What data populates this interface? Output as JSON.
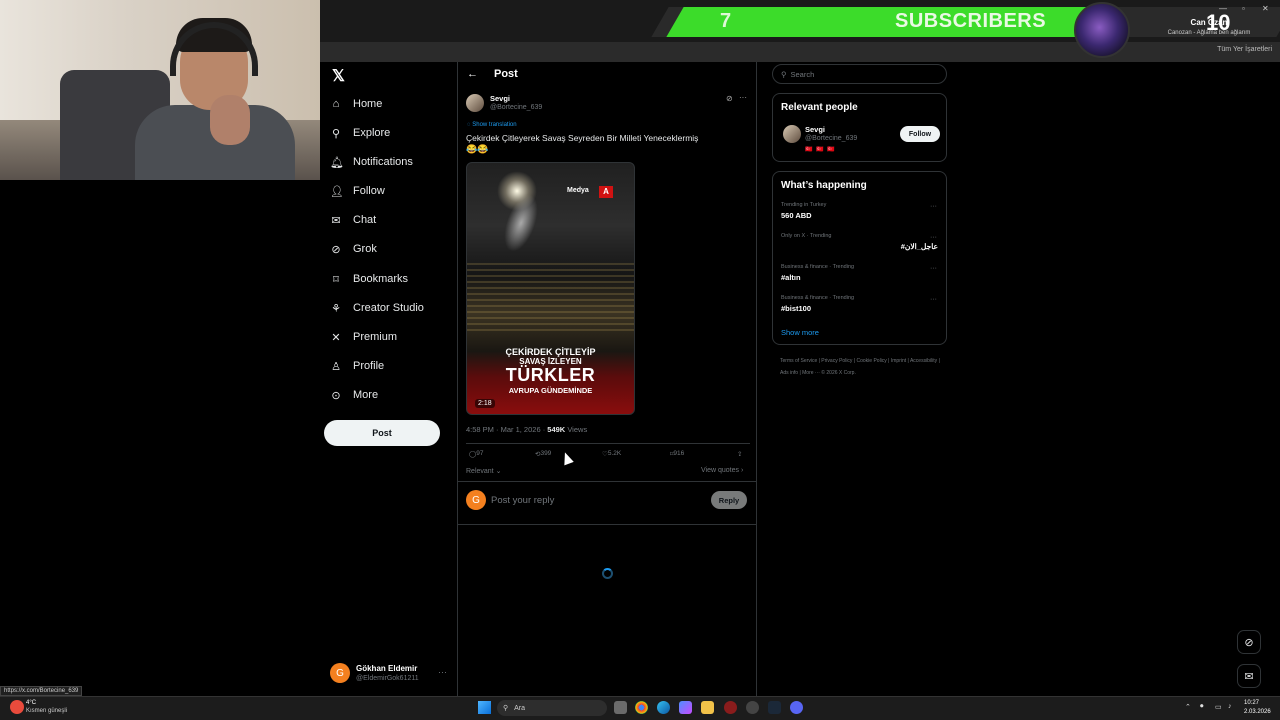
{
  "overlay": {
    "subs_current": "7",
    "subs_label": "SUBSCRIBERS",
    "subs_goal": "10",
    "profile_name": "Can Ozan",
    "profile_sub": "Canozan - Ağlama ben ağlarım",
    "bookmarks_label": "Tüm Yer İşaretleri"
  },
  "nav": {
    "logo": "𝕏",
    "items": [
      {
        "label": "Home",
        "icon": "home-icon"
      },
      {
        "label": "Explore",
        "icon": "search-icon"
      },
      {
        "label": "Notifications",
        "icon": "bell-icon"
      },
      {
        "label": "Follow",
        "icon": "add-person-icon"
      },
      {
        "label": "Chat",
        "icon": "mail-icon"
      },
      {
        "label": "Grok",
        "icon": "grok-icon"
      },
      {
        "label": "Bookmarks",
        "icon": "bookmark-icon"
      },
      {
        "label": "Creator Studio",
        "icon": "studio-icon"
      },
      {
        "label": "Premium",
        "icon": "x-icon"
      },
      {
        "label": "Profile",
        "icon": "person-icon"
      },
      {
        "label": "More",
        "icon": "more-circle-icon"
      }
    ],
    "post_button": "Post",
    "account": {
      "initial": "G",
      "name": "Gökhan Eldemir",
      "handle": "@EldemirGok61211"
    }
  },
  "post": {
    "header_title": "Post",
    "author": {
      "name": "Sevgi",
      "handle": "@Bortecine_639"
    },
    "show_translation": "Show translation",
    "text": "Çekirdek Çitleyerek Savaş Seyreden Bir Milleti Yeneceklermiş",
    "emoji": "😂😂",
    "media": {
      "brand": "Medya",
      "brand_mark": "A",
      "line1": "ÇEKİRDEK ÇİTLEYİP",
      "line2": "SAVAŞ İZLEYEN",
      "line3": "TÜRKLER",
      "line4": "AVRUPA GÜNDEMİNDE",
      "duration": "2:18"
    },
    "time": "4:58 PM · Mar 1, 2026 · ",
    "views_count": "549K",
    "views_label": " Views",
    "stats": {
      "replies": "97",
      "reposts": "399",
      "likes": "5.2K",
      "bookmarks": "916"
    },
    "sort_label": "Relevant ⌄",
    "view_quotes": "View quotes ›",
    "reply": {
      "initial": "G",
      "placeholder": "Post your reply",
      "button": "Reply"
    }
  },
  "sidebar": {
    "search_placeholder": "Search",
    "relevant_title": "Relevant people",
    "relevant_person": {
      "name": "Sevgi",
      "handle": "@Bortecine_639",
      "flags": "🇹🇷 🇹🇷 🇹🇷",
      "follow": "Follow"
    },
    "happening_title": "What’s happening",
    "trends": [
      {
        "category": "Trending in Turkey",
        "name": "560 ABD"
      },
      {
        "category": "Only on X · Trending",
        "name": "#عاجل_الان"
      },
      {
        "category": "Business & finance · Trending",
        "name": "#altın"
      },
      {
        "category": "Business & finance · Trending",
        "name": "#bist100"
      }
    ],
    "show_more": "Show more",
    "footer": "Terms of Service | Privacy Policy | Cookie Policy | Imprint | Accessibility | Ads info | More ··· © 2026 X Corp."
  },
  "status_url": "https://x.com/Bortecine_639",
  "taskbar": {
    "weather_temp": "4°C",
    "weather_desc": "Kısmen güneşli",
    "search_label": "Ara",
    "time": "10:27",
    "date": "2.03.2026"
  },
  "colors": {
    "accent": "#1d9bf0",
    "subs_bar": "#3cdc2a",
    "avatar_orange": "#f4801f"
  }
}
